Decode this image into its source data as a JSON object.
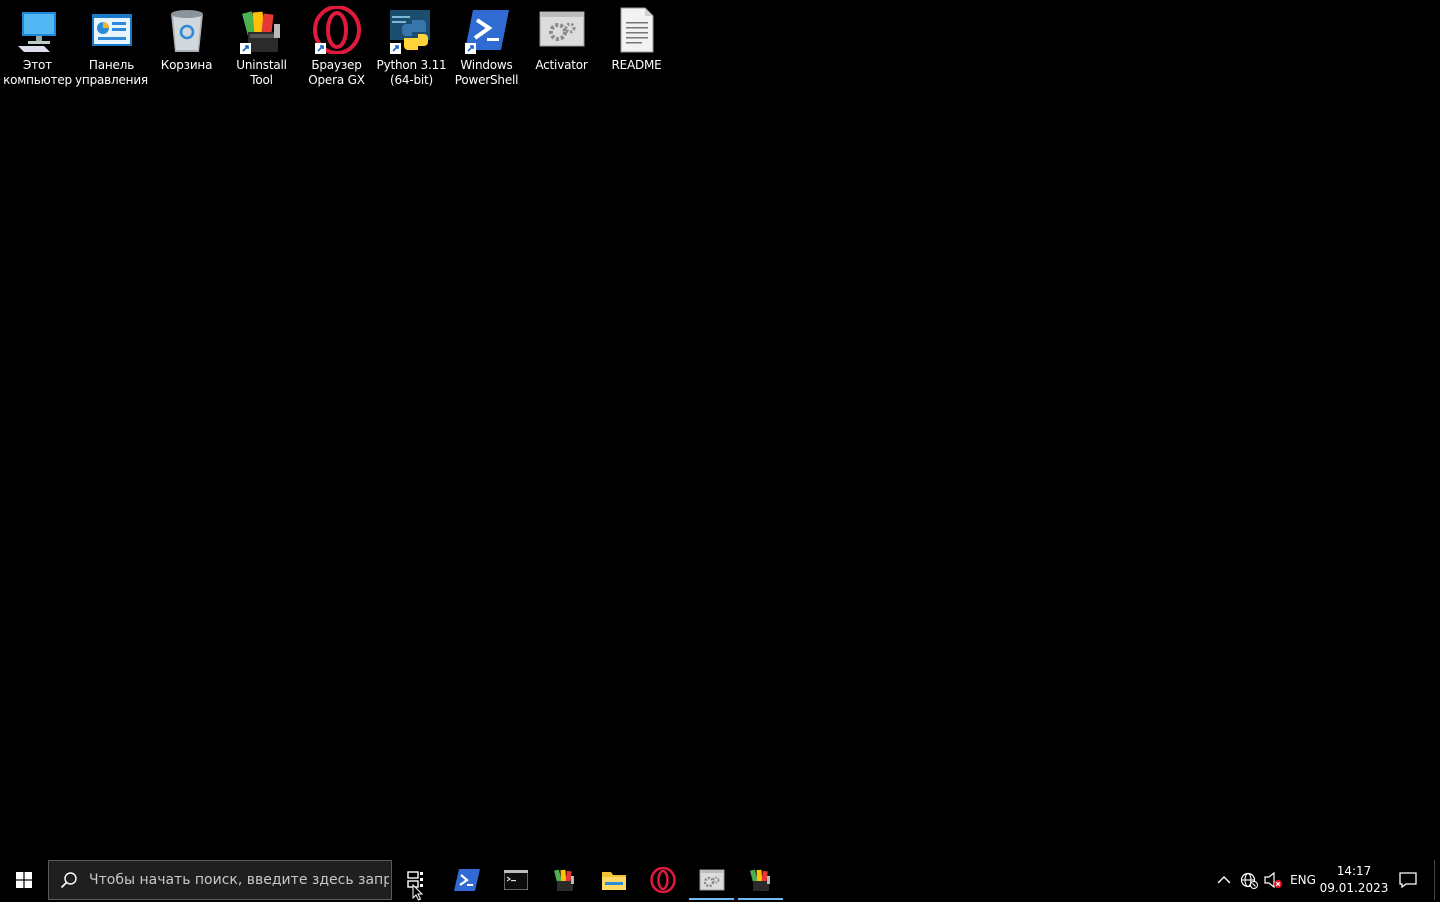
{
  "desktop": {
    "icons": [
      {
        "label": "Этот\nкомпьютер",
        "icon": "this-pc-icon"
      },
      {
        "label": "Панель\nуправления",
        "icon": "control-panel-icon"
      },
      {
        "label": "Корзина",
        "icon": "recycle-bin-icon"
      },
      {
        "label": "Uninstall Tool",
        "icon": "uninstall-tool-icon"
      },
      {
        "label": "Браузер\nOpera GX",
        "icon": "opera-gx-icon"
      },
      {
        "label": "Python 3.11\n(64-bit)",
        "icon": "python-icon"
      },
      {
        "label": "Windows\nPowerShell",
        "icon": "powershell-icon"
      },
      {
        "label": "Activator",
        "icon": "activator-icon"
      },
      {
        "label": "README",
        "icon": "text-file-icon"
      }
    ]
  },
  "taskbar": {
    "search_placeholder": "Чтобы начать поиск, введите здесь запрос",
    "apps": [
      {
        "name": "powershell",
        "icon": "powershell-icon",
        "active": false
      },
      {
        "name": "command-prompt",
        "icon": "cmd-icon",
        "active": false
      },
      {
        "name": "uninstall-tool",
        "icon": "uninstall-tool-icon",
        "active": false
      },
      {
        "name": "file-explorer",
        "icon": "folder-icon",
        "active": false
      },
      {
        "name": "opera-gx",
        "icon": "opera-gx-icon",
        "active": false
      },
      {
        "name": "activator",
        "icon": "activator-icon",
        "active": true
      },
      {
        "name": "uninstall-tool-2",
        "icon": "uninstall-tool-icon",
        "active": true
      }
    ],
    "tray": {
      "language": "ENG",
      "time": "14:17",
      "date": "09.01.2023"
    }
  },
  "colors": {
    "background": "#000000",
    "active_underline": "#76b9ed",
    "search_bg": "#1f1f1f"
  }
}
